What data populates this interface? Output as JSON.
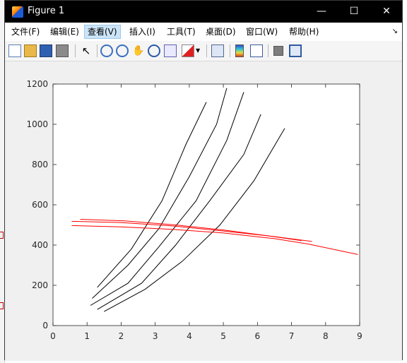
{
  "window": {
    "title": "Figure 1"
  },
  "menu": [
    {
      "label": "文件(F)"
    },
    {
      "label": "编辑(E)"
    },
    {
      "label": "查看(V)"
    },
    {
      "label": "插入(I)"
    },
    {
      "label": "工具(T)"
    },
    {
      "label": "桌面(D)"
    },
    {
      "label": "窗口(W)"
    },
    {
      "label": "帮助(H)"
    }
  ],
  "toolbar": [
    "new-figure-icon",
    "open-icon",
    "save-icon",
    "print-icon",
    "pointer-icon",
    "zoom-in-icon",
    "zoom-out-icon",
    "pan-icon",
    "rotate-icon",
    "data-cursor-icon",
    "brush-icon",
    "brush-dropdown-icon",
    "link-plot-icon",
    "colorbar-icon",
    "legend-icon",
    "hide-plot-tools-icon",
    "show-plot-tools-icon"
  ],
  "colors": {
    "black_series": "#000000",
    "red_series": "#ff0000"
  },
  "chart_data": {
    "type": "line",
    "title": "",
    "xlabel": "",
    "ylabel": "",
    "xlim": [
      0,
      9
    ],
    "ylim": [
      0,
      1200
    ],
    "x_ticks": [
      "0",
      "1",
      "2",
      "3",
      "4",
      "5",
      "6",
      "7",
      "8",
      "9"
    ],
    "y_ticks": [
      "0",
      "200",
      "400",
      "600",
      "800",
      "1000",
      "1200"
    ],
    "grid": false,
    "series": [
      {
        "color": "#000000",
        "x": [
          1.3,
          2.3,
          3.2,
          3.9,
          4.5
        ],
        "y": [
          190,
          380,
          620,
          900,
          1110
        ]
      },
      {
        "color": "#000000",
        "x": [
          1.15,
          2.2,
          3.1,
          4.0,
          4.8,
          5.1
        ],
        "y": [
          135,
          300,
          480,
          740,
          1000,
          1180
        ]
      },
      {
        "color": "#000000",
        "x": [
          1.1,
          2.2,
          3.1,
          4.2,
          5.1,
          5.6
        ],
        "y": [
          100,
          210,
          390,
          620,
          920,
          1160
        ]
      },
      {
        "color": "#000000",
        "x": [
          1.3,
          2.6,
          3.6,
          4.6,
          5.6,
          6.1
        ],
        "y": [
          80,
          210,
          400,
          620,
          850,
          1050
        ]
      },
      {
        "color": "#000000",
        "x": [
          1.5,
          2.7,
          3.8,
          4.9,
          5.9,
          6.8
        ],
        "y": [
          70,
          180,
          320,
          500,
          720,
          980
        ]
      },
      {
        "color": "#ff0000",
        "x": [
          0.55,
          2,
          3.5,
          5,
          6.5,
          7.6
        ],
        "y": [
          518,
          512,
          495,
          470,
          442,
          418
        ]
      },
      {
        "color": "#ff0000",
        "x": [
          0.8,
          2.1,
          3.6,
          5,
          6.4,
          7.3
        ],
        "y": [
          528,
          520,
          500,
          475,
          444,
          422
        ]
      },
      {
        "color": "#ff0000",
        "x": [
          0.55,
          2,
          3.5,
          5,
          6.5,
          7.5,
          8.95
        ],
        "y": [
          497,
          490,
          478,
          460,
          432,
          405,
          353
        ]
      }
    ]
  }
}
